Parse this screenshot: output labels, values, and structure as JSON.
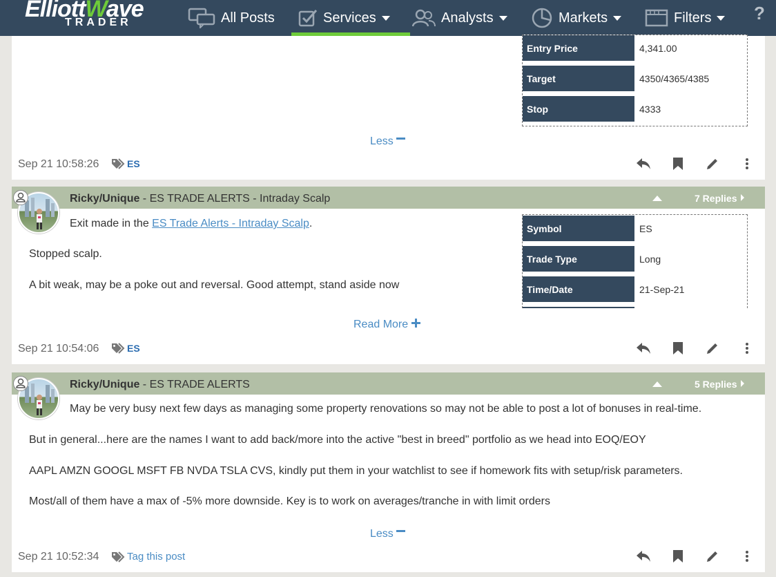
{
  "nav": {
    "logo_top": "ElliottWave",
    "logo_bottom": "TRADER",
    "items": [
      "All Posts",
      "Services",
      "Analysts",
      "Markets",
      "Filters"
    ],
    "help": "?"
  },
  "post1": {
    "trade_rows": [
      {
        "key": "Entry Price",
        "value": "4,341.00"
      },
      {
        "key": "Target",
        "value": "4350/4365/4385"
      },
      {
        "key": "Stop",
        "value": "4333"
      }
    ],
    "toggle": "Less",
    "timestamp": "Sep 21 10:58:26",
    "tag": "ES"
  },
  "post2": {
    "author": "Ricky/Unique",
    "title": " - ES TRADE ALERTS - Intraday Scalp",
    "replies": "7 Replies",
    "exit_prefix": "Exit made in the ",
    "exit_link": "ES Trade Alerts - Intraday Scalp",
    "exit_suffix": ".",
    "line1": "Stopped scalp.",
    "line2": "A bit weak, may be a poke out and reversal. Good attempt, stand aside now",
    "trade_rows": [
      {
        "key": "Symbol",
        "value": "ES"
      },
      {
        "key": "Trade Type",
        "value": "Long"
      },
      {
        "key": "Time/Date",
        "value": "21-Sep-21"
      }
    ],
    "toggle": "Read More",
    "timestamp": "Sep 21 10:54:06",
    "tag": "ES"
  },
  "post3": {
    "author": "Ricky/Unique",
    "title": " - ES TRADE ALERTS",
    "replies": "5 Replies",
    "line1": "May be very busy next few days as managing some property renovations so may not be able to post a lot of bonuses in real-time.",
    "line2": "But in general...here are the names I want to add back/more into the active \"best in breed\" portfolio as we head into EOQ/EOY",
    "line3": "AAPL AMZN GOOGL MSFT FB NVDA TSLA CVS, kindly put them in your watchlist to see if homework fits with setup/risk parameters.",
    "line4": "Most/all of them have a max of -5% more downside. Key is to work on averages/tranche in with limit orders",
    "toggle": "Less",
    "timestamp": "Sep 21 10:52:34",
    "tag": "Tag this post"
  }
}
